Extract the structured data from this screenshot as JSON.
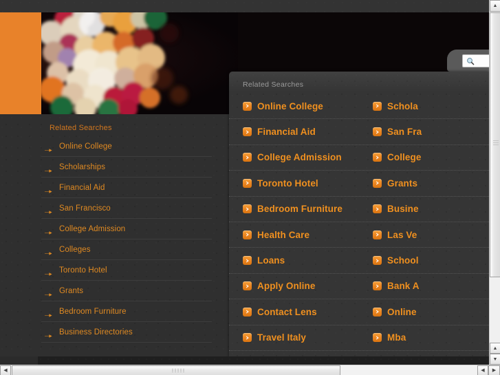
{
  "search": {
    "placeholder": "",
    "value": "",
    "icon": "search-icon"
  },
  "sidebar": {
    "title": "Related Searches",
    "items": [
      {
        "label": "Online College"
      },
      {
        "label": "Scholarships"
      },
      {
        "label": "Financial Aid"
      },
      {
        "label": "San Francisco"
      },
      {
        "label": "College Admission"
      },
      {
        "label": "Colleges"
      },
      {
        "label": "Toronto Hotel"
      },
      {
        "label": "Grants"
      },
      {
        "label": "Bedroom Furniture"
      },
      {
        "label": "Business Directories"
      }
    ]
  },
  "overlay": {
    "title": "Related Searches",
    "rows": [
      {
        "left": "Online College",
        "right": "Schola"
      },
      {
        "left": "Financial Aid",
        "right": "San Fra"
      },
      {
        "left": "College Admission",
        "right": "College"
      },
      {
        "left": "Toronto Hotel",
        "right": "Grants"
      },
      {
        "left": "Bedroom Furniture",
        "right": "Busine"
      },
      {
        "left": "Health Care",
        "right": "Las Ve"
      },
      {
        "left": "Loans",
        "right": "School"
      },
      {
        "left": "Apply Online",
        "right": "Bank A"
      },
      {
        "left": "Contact Lens",
        "right": "Online "
      },
      {
        "left": "Travel Italy",
        "right": "Mba"
      }
    ]
  },
  "colors": {
    "accent_orange": "#e8822a",
    "link_orange": "#f0901f",
    "sidebar_link": "#e08a22",
    "page_bg": "#2f2f2f",
    "overlay_bg": "#353535",
    "overlay_title": "#9a9a9a"
  },
  "scrollbars": {
    "vertical": {
      "up_arrow": "▲",
      "down_arrow": "▼"
    },
    "horizontal": {
      "left_arrow": "◀",
      "right_arrow": "▶"
    }
  }
}
